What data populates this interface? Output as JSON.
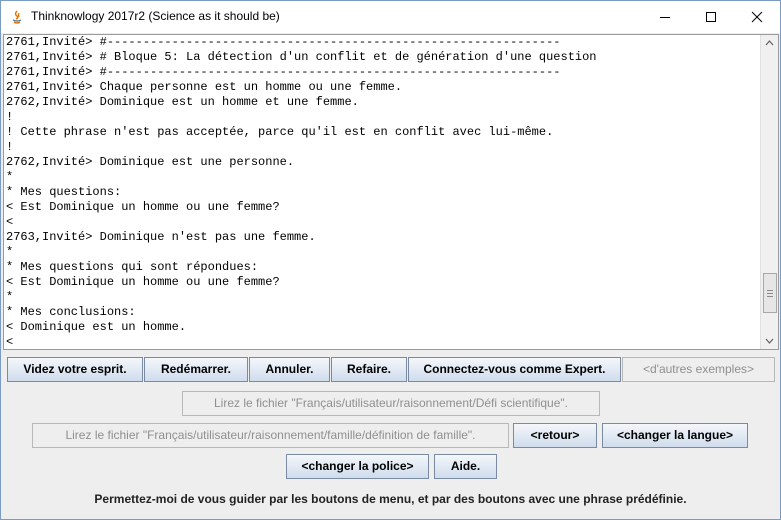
{
  "window": {
    "title": "Thinknowlogy 2017r2 (Science as it should be)"
  },
  "console": {
    "lines": [
      "2761,Invité> #---------------------------------------------------------------",
      "2761,Invité> # Bloque 5: La détection d'un conflit et de génération d'une question",
      "2761,Invité> #---------------------------------------------------------------",
      "2761,Invité> Chaque personne est un homme ou une femme.",
      "2762,Invité> Dominique est un homme et une femme.",
      "!",
      "! Cette phrase n'est pas acceptée, parce qu'il est en conflit avec lui-même.",
      "!",
      "2762,Invité> Dominique est une personne.",
      "*",
      "* Mes questions:",
      "< Est Dominique un homme ou une femme?",
      "<",
      "2763,Invité> Dominique n'est pas une femme.",
      "*",
      "* Mes questions qui sont répondues:",
      "< Est Dominique un homme ou une femme?",
      "*",
      "* Mes conclusions:",
      "< Dominique est un homme.",
      "<"
    ]
  },
  "toolbar": {
    "clear_mind": "Videz votre esprit.",
    "restart": "Redémarrer.",
    "undo": "Annuler.",
    "redo": "Refaire.",
    "login_expert": "Connectez-vous comme Expert.",
    "other_examples": "<d'autres exemples>"
  },
  "files": {
    "read_challenge": "Lirez le fichier \"Français/utilisateur/raisonnement/Défi scientifique\".",
    "read_family": "Lirez le fichier \"Français/utilisateur/raisonnement/famille/définition de famille\".",
    "back": "<retour>",
    "change_language": "<changer la langue>",
    "change_font": "<changer la police>",
    "help": "Aide."
  },
  "guide_text": "Permettez-moi de vous guider par les boutons de menu, et par des boutons avec une phrase prédéfinie."
}
